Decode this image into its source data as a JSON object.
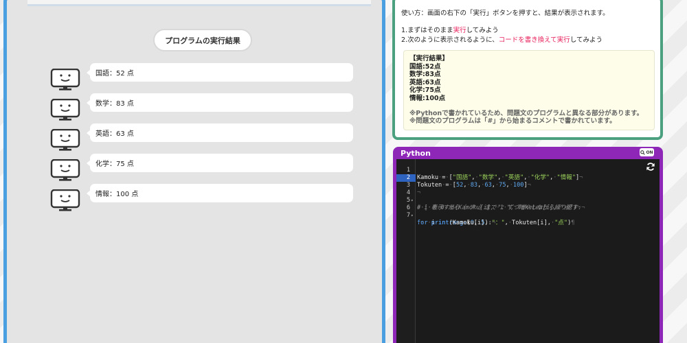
{
  "result_panel": {
    "title": "プログラムの実行結果",
    "outputs": [
      {
        "text": "国語：52 点"
      },
      {
        "text": "数学：83 点"
      },
      {
        "text": "英語：63 点"
      },
      {
        "text": "化学：75 点"
      },
      {
        "text": "情報：100 点"
      }
    ],
    "icon": "monitor-face-icon"
  },
  "instructions": {
    "usage": "使い方：画面の右下の「実行」ボタンを押すと、結果が表示されます。",
    "step1_prefix": "1.まずはそのまま",
    "step1_highlight": "実行",
    "step1_suffix": "してみよう",
    "step2_prefix": "2.次のように表示されるように、",
    "step2_highlight": "コードを書き換えて実行",
    "step2_suffix": "してみよう",
    "highlight_color": "#e8215c",
    "expected": {
      "header": "【実行結果】",
      "lines": [
        "国語:52点",
        "数学:83点",
        "英語:63点",
        "化学:75点",
        "情報:100点"
      ],
      "note1": "※Pythonで書かれているため、問題文のプログラムと異なる部分があります。",
      "note2": "※問題文のプログラムは「#」から始まるコメントで書かれています。"
    }
  },
  "editor": {
    "language": "Python",
    "zoom_label": "ON",
    "run_icon": "refresh-icon",
    "active_line": 2,
    "lines": [
      {
        "num": "1",
        "fold": ""
      },
      {
        "num": "2",
        "fold": ""
      },
      {
        "num": "3",
        "fold": ""
      },
      {
        "num": "4",
        "fold": "▾"
      },
      {
        "num": "5",
        "fold": ""
      },
      {
        "num": "6",
        "fold": "▾"
      },
      {
        "num": "7",
        "fold": ""
      }
    ]
  },
  "colors": {
    "result_border": "#4a9fe0",
    "info_border": "#4aa07f",
    "editor_header": "#8e27b8"
  }
}
